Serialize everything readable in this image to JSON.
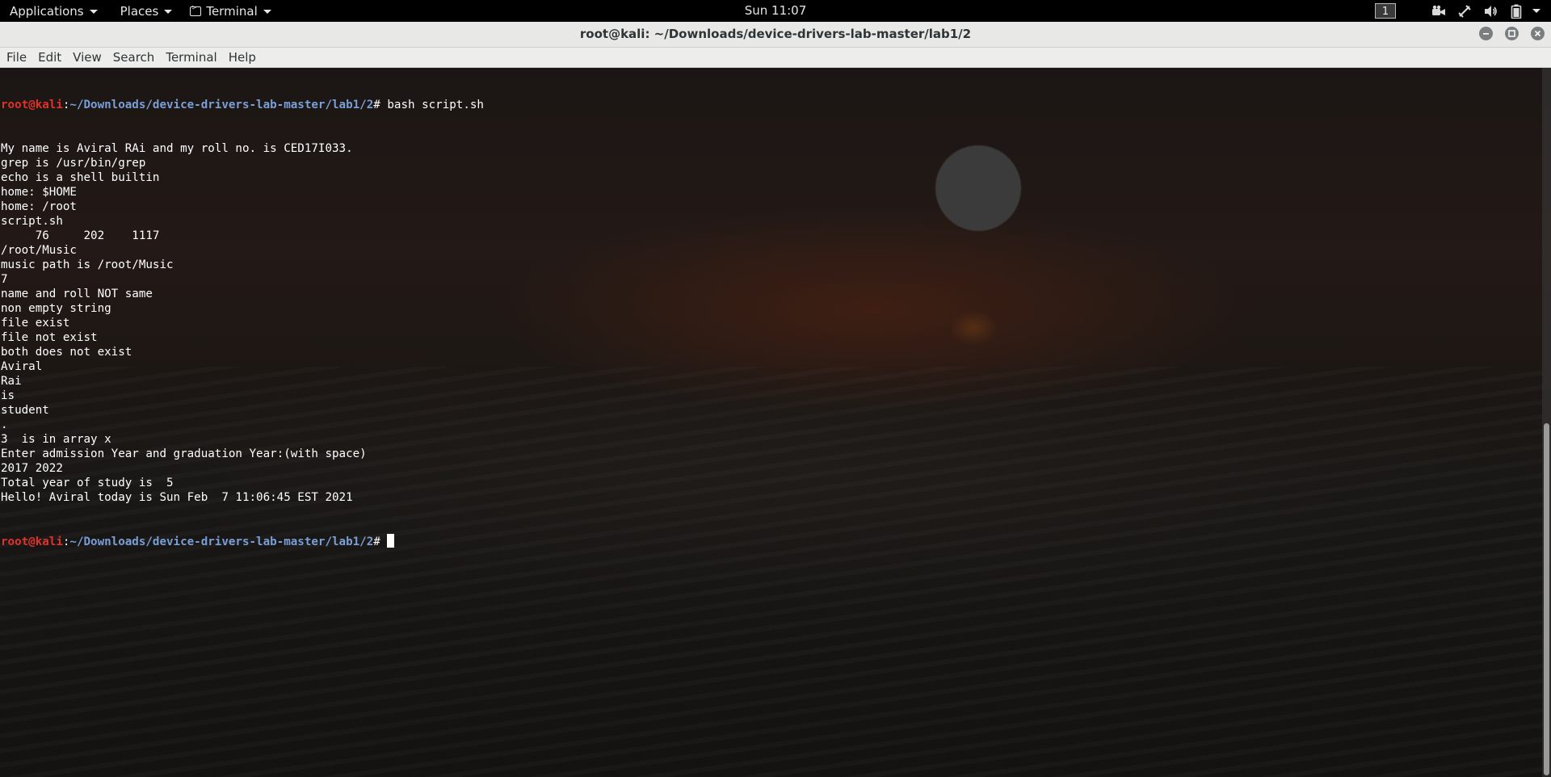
{
  "topbar": {
    "applications_label": "Applications",
    "places_label": "Places",
    "terminal_label": "Terminal",
    "clock": "Sun 11:07",
    "workspace_number": "1"
  },
  "window": {
    "title": "root@kali: ~/Downloads/device-drivers-lab-master/lab1/2",
    "menu": [
      "File",
      "Edit",
      "View",
      "Search",
      "Terminal",
      "Help"
    ]
  },
  "terminal": {
    "prompt_user": "root@kali",
    "prompt_sep": ":",
    "prompt_path": "~/Downloads/device-drivers-lab-master/lab1/2",
    "prompt_symbol": "# ",
    "command": "bash script.sh",
    "output": [
      "My name is Aviral RAi and my roll no. is CED17I033.",
      "grep is /usr/bin/grep",
      "echo is a shell builtin",
      "home: $HOME",
      "home: /root",
      "script.sh",
      "     76     202    1117",
      "/root/Music",
      "music path is /root/Music",
      "7",
      "name and roll NOT same",
      "non empty string",
      "file exist",
      "file not exist",
      "both does not exist",
      "Aviral",
      "Rai",
      "is",
      "student",
      ".",
      "3  is in array x",
      "Enter admission Year and graduation Year:(with space)",
      "2017 2022",
      "Total year of study is  5",
      "Hello! Aviral today is Sun Feb  7 11:06:45 EST 2021"
    ]
  },
  "icons": {
    "terminal": "terminal-icon",
    "video": "video-camera-icon",
    "network": "network-icon",
    "volume": "volume-icon",
    "battery": "battery-icon",
    "minimize": "minimize-icon",
    "maximize": "maximize-icon",
    "close": "close-icon"
  }
}
